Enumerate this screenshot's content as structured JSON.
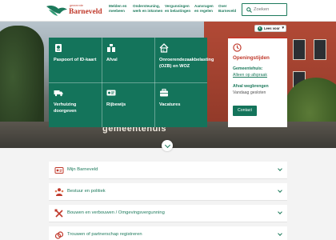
{
  "header": {
    "logo_small": "gemeente",
    "logo_name": "Barneveld",
    "nav": [
      {
        "line1": "Melden en",
        "line2": "meebeen"
      },
      {
        "line1": "Ondersteuning,",
        "line2": "werk en inkomen"
      },
      {
        "line1": "Vergunningen",
        "line2": "en belastingen"
      },
      {
        "line1": "Aanvragen",
        "line2": "en regelen"
      },
      {
        "line1": "Over",
        "line2": "Barneveld"
      }
    ],
    "search_placeholder": "Zoeken"
  },
  "hero": {
    "facade_text": "gemeentehuis",
    "lees_voor": "Lees voor"
  },
  "tiles": [
    {
      "label": "Paspoort of ID-kaart",
      "icon": "passport-icon"
    },
    {
      "label": "Afval",
      "icon": "waste-icon"
    },
    {
      "label": "Onroerendezaakbelasting (OZB) en WOZ",
      "icon": "house-euro-icon"
    },
    {
      "label": "Verhuizing doorgeven",
      "icon": "truck-icon"
    },
    {
      "label": "Rijbewijs",
      "icon": "driving-licence-icon"
    },
    {
      "label": "Vacatures",
      "icon": "briefcase-icon"
    }
  ],
  "opening": {
    "title": "Openingstijden",
    "gemeentehuis_label": "Gemeentehuis:",
    "gemeentehuis_value": "Alleen op afspraak",
    "afval_label": "Afval wegbrengen",
    "afval_value": "Vandaag gesloten",
    "contact_button": "Contact"
  },
  "accordion": [
    {
      "label": "Mijn Barneveld",
      "icon": "id-card-icon"
    },
    {
      "label": "Bestuur en politiek",
      "icon": "people-icon"
    },
    {
      "label": "Bouwen en verbouwen / Omgevingsvergunning",
      "icon": "tools-icon"
    },
    {
      "label": "Trouwen of partnerschap registreren",
      "icon": "rings-icon"
    }
  ],
  "colors": {
    "brand_green": "#14745b",
    "brand_red": "#c0392b"
  }
}
